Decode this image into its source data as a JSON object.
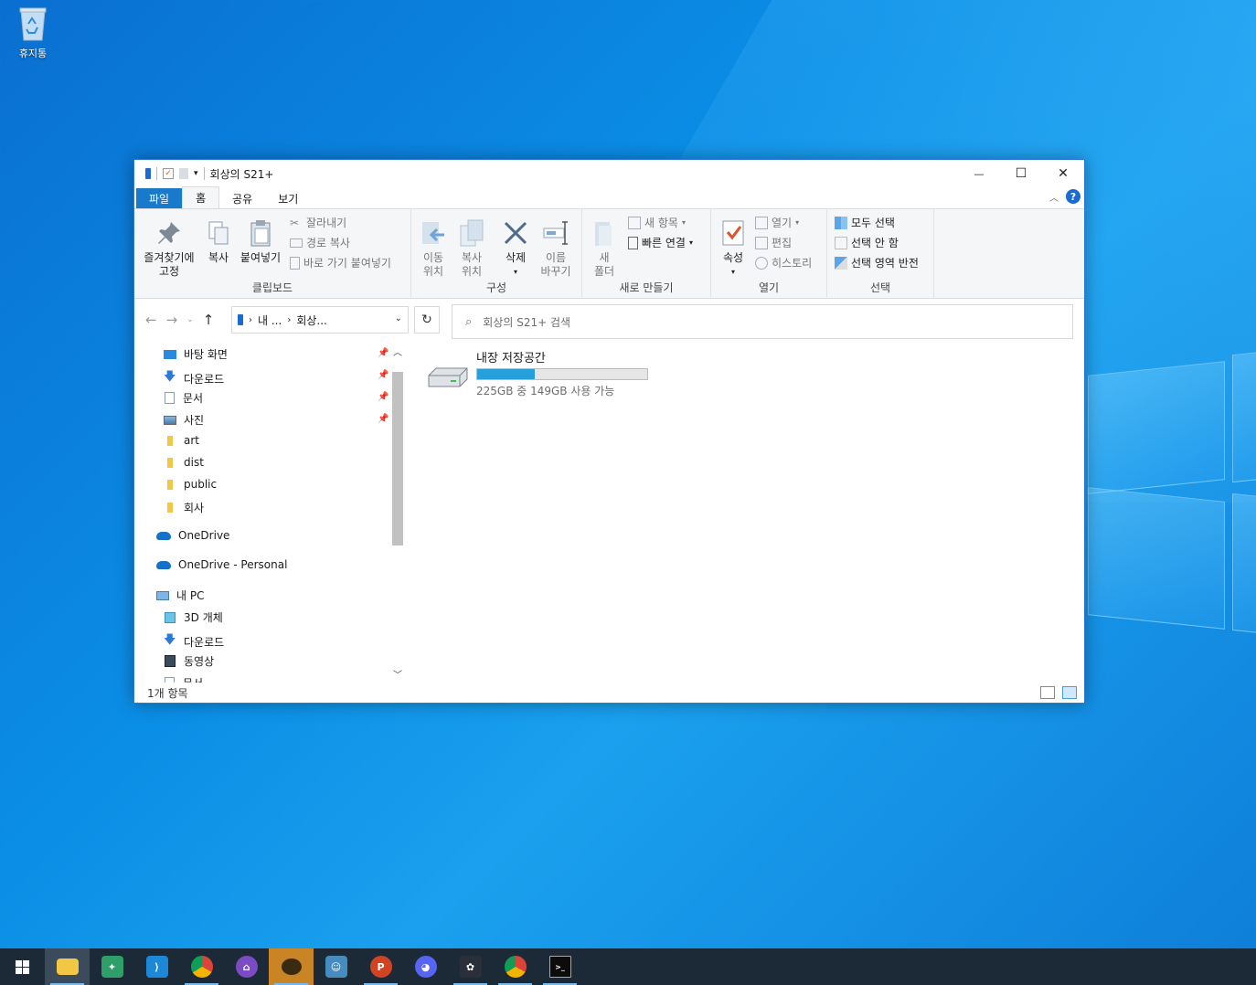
{
  "desktop": {
    "icons": [
      {
        "label": "휴지통",
        "icon": "recycle-bin-icon"
      }
    ]
  },
  "window": {
    "title": "회상의 S21+",
    "controls": {
      "minimize": "—",
      "maximize": "☐",
      "close": "✕"
    }
  },
  "ribbon_tabs": [
    {
      "label": "파일",
      "state": "file"
    },
    {
      "label": "홈",
      "state": "active"
    },
    {
      "label": "공유",
      "state": "normal"
    },
    {
      "label": "보기",
      "state": "normal"
    }
  ],
  "ribbon": {
    "clipboard": {
      "label": "클립보드",
      "pin_label": "즐겨찾기에\n고정",
      "copy": "복사",
      "paste": "붙여넣기",
      "cut": "잘라내기",
      "copy_path": "경로 복사",
      "paste_shortcut": "바로 가기 붙여넣기"
    },
    "organize": {
      "label": "구성",
      "move_to": "이동\n위치",
      "copy_to": "복사\n위치",
      "delete": "삭제",
      "rename": "이름\n바꾸기"
    },
    "new": {
      "label": "새로 만들기",
      "new_folder": "새\n폴더",
      "new_item": "새 항목",
      "easy_access": "빠른 연결"
    },
    "open": {
      "label": "열기",
      "properties": "속성",
      "open": "열기",
      "edit": "편집",
      "history": "히스토리"
    },
    "select": {
      "label": "선택",
      "select_all": "모두 선택",
      "select_none": "선택 안 함",
      "invert": "선택 영역 반전"
    }
  },
  "address": {
    "crumbs": [
      "내 ...",
      "회상..."
    ],
    "search_placeholder": "회상의 S21+ 검색"
  },
  "nav_pane": {
    "quick_access": [
      {
        "label": "바탕 화면",
        "icon": "desktop-folder-icon",
        "pinned": true
      },
      {
        "label": "다운로드",
        "icon": "download-arrow-icon",
        "pinned": true
      },
      {
        "label": "문서",
        "icon": "document-icon",
        "pinned": true
      },
      {
        "label": "사진",
        "icon": "pictures-icon",
        "pinned": true
      },
      {
        "label": "art",
        "icon": "folder-icon",
        "pinned": false
      },
      {
        "label": "dist",
        "icon": "folder-icon",
        "pinned": false
      },
      {
        "label": "public",
        "icon": "folder-icon",
        "pinned": false
      },
      {
        "label": "회사",
        "icon": "folder-icon",
        "pinned": false
      }
    ],
    "onedrive": "OneDrive",
    "onedrive_personal": "OneDrive - Personal",
    "this_pc": "내 PC",
    "pc_children": [
      {
        "label": "3D 개체",
        "icon": "3d-objects-icon"
      },
      {
        "label": "다운로드",
        "icon": "download-arrow-icon"
      },
      {
        "label": "동영상",
        "icon": "video-icon"
      },
      {
        "label": "문서",
        "icon": "document-icon"
      }
    ]
  },
  "drive": {
    "name": "내장 저장공간",
    "free_text": "225GB 중 149GB 사용 가능",
    "used_fraction": 0.34
  },
  "status": {
    "count": "1개 항목"
  },
  "taskbar": {
    "items": [
      {
        "name": "start-button",
        "icon": "windows-logo-icon"
      },
      {
        "name": "file-explorer",
        "icon": "folder-icon",
        "active": true
      },
      {
        "name": "app-2",
        "icon": "tool-icon"
      },
      {
        "name": "vscode",
        "icon": "vscode-icon"
      },
      {
        "name": "chrome-user",
        "icon": "chrome-icon"
      },
      {
        "name": "github-desktop",
        "icon": "github-icon"
      },
      {
        "name": "kakaotalk",
        "icon": "chat-bubble-icon",
        "highlight": true
      },
      {
        "name": "godot",
        "icon": "godot-icon"
      },
      {
        "name": "powerpoint",
        "icon": "powerpoint-icon"
      },
      {
        "name": "discord",
        "icon": "discord-icon"
      },
      {
        "name": "davinci",
        "icon": "davinci-icon"
      },
      {
        "name": "chrome",
        "icon": "chrome-icon"
      },
      {
        "name": "terminal",
        "icon": "terminal-icon"
      }
    ]
  },
  "colors": {
    "accent": "#1979ca",
    "progress": "#26a0da",
    "taskbar": "#1c2a38"
  }
}
